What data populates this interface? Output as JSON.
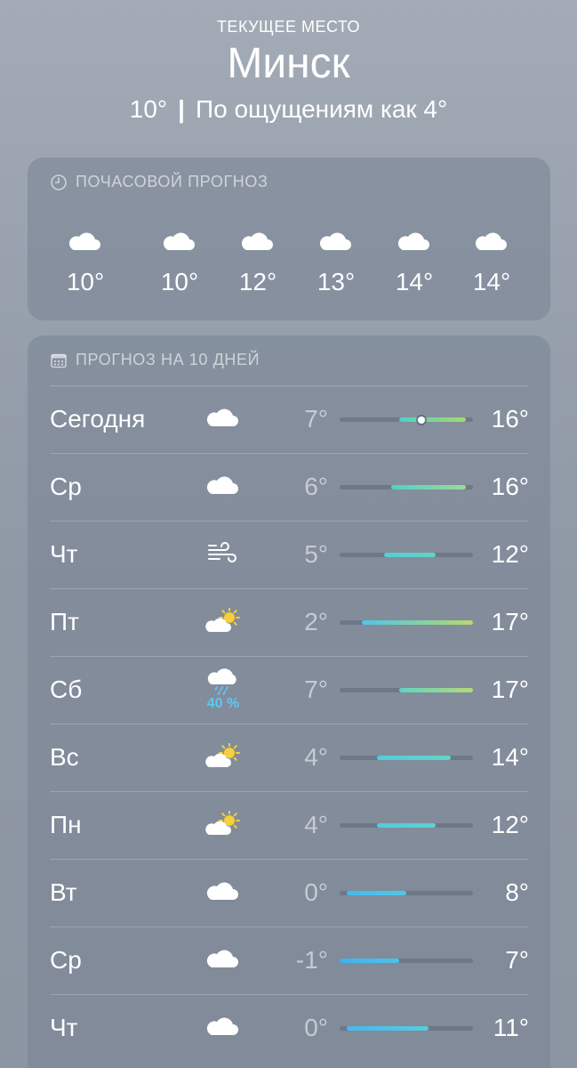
{
  "header": {
    "location_label": "ТЕКУЩЕЕ МЕСТО",
    "city": "Минск",
    "current_temp": "10°",
    "separator": "|",
    "feels_like": "По ощущениям как 4°"
  },
  "hourly": {
    "title": "ПОЧАСОВОЙ ПРОГНОЗ",
    "title_icon": "clock-icon",
    "items": [
      {
        "icon": "cloud-icon",
        "temp": "10°"
      },
      {
        "icon": "cloud-icon",
        "temp": "10°"
      },
      {
        "icon": "cloud-icon",
        "temp": "12°"
      },
      {
        "icon": "cloud-icon",
        "temp": "13°"
      },
      {
        "icon": "cloud-icon",
        "temp": "14°"
      },
      {
        "icon": "cloud-icon",
        "temp": "14°"
      }
    ]
  },
  "daily": {
    "title": "ПРОГНОЗ НА 10 ДНЕЙ",
    "title_icon": "calendar-icon",
    "range_min": -1,
    "range_max": 17,
    "days": [
      {
        "day": "Сегодня",
        "icon": "cloud-icon",
        "precip": "",
        "low": "7°",
        "high": "16°",
        "low_v": 7,
        "high_v": 16,
        "current_v": 10,
        "colors": [
          "#4fd1c5",
          "#a6d86a"
        ]
      },
      {
        "day": "Ср",
        "icon": "cloud-icon",
        "precip": "",
        "low": "6°",
        "high": "16°",
        "low_v": 6,
        "high_v": 16,
        "colors": [
          "#4fd1c5",
          "#9ed99a"
        ]
      },
      {
        "day": "Чт",
        "icon": "wind-icon",
        "precip": "",
        "low": "5°",
        "high": "12°",
        "low_v": 5,
        "high_v": 12,
        "colors": [
          "#54cfd6",
          "#5fd4c4"
        ]
      },
      {
        "day": "Пт",
        "icon": "partly-sunny-icon",
        "precip": "",
        "low": "2°",
        "high": "17°",
        "low_v": 2,
        "high_v": 17,
        "colors": [
          "#4bc7e8",
          "#b8d86a"
        ]
      },
      {
        "day": "Сб",
        "icon": "rain-cloud-icon",
        "precip": "40 %",
        "low": "7°",
        "high": "17°",
        "low_v": 7,
        "high_v": 17,
        "colors": [
          "#5fd4c0",
          "#b5d97a"
        ]
      },
      {
        "day": "Вс",
        "icon": "partly-sunny-icon",
        "precip": "",
        "low": "4°",
        "high": "14°",
        "low_v": 4,
        "high_v": 14,
        "colors": [
          "#52cbe0",
          "#64d4c6"
        ]
      },
      {
        "day": "Пн",
        "icon": "partly-sunny-icon",
        "precip": "",
        "low": "4°",
        "high": "12°",
        "low_v": 4,
        "high_v": 12,
        "colors": [
          "#52cbe0",
          "#5dd0d4"
        ]
      },
      {
        "day": "Вт",
        "icon": "cloud-icon",
        "precip": "",
        "low": "0°",
        "high": "8°",
        "low_v": 0,
        "high_v": 8,
        "colors": [
          "#45b8f0",
          "#50c8e4"
        ]
      },
      {
        "day": "Ср",
        "icon": "cloud-icon",
        "precip": "",
        "low": "-1°",
        "high": "7°",
        "low_v": -1,
        "high_v": 7,
        "colors": [
          "#40b2f0",
          "#4cc2e8"
        ]
      },
      {
        "day": "Чт",
        "icon": "cloud-icon",
        "precip": "",
        "low": "0°",
        "high": "11°",
        "low_v": 0,
        "high_v": 11,
        "colors": [
          "#45b8f0",
          "#55ccdc"
        ]
      }
    ]
  }
}
